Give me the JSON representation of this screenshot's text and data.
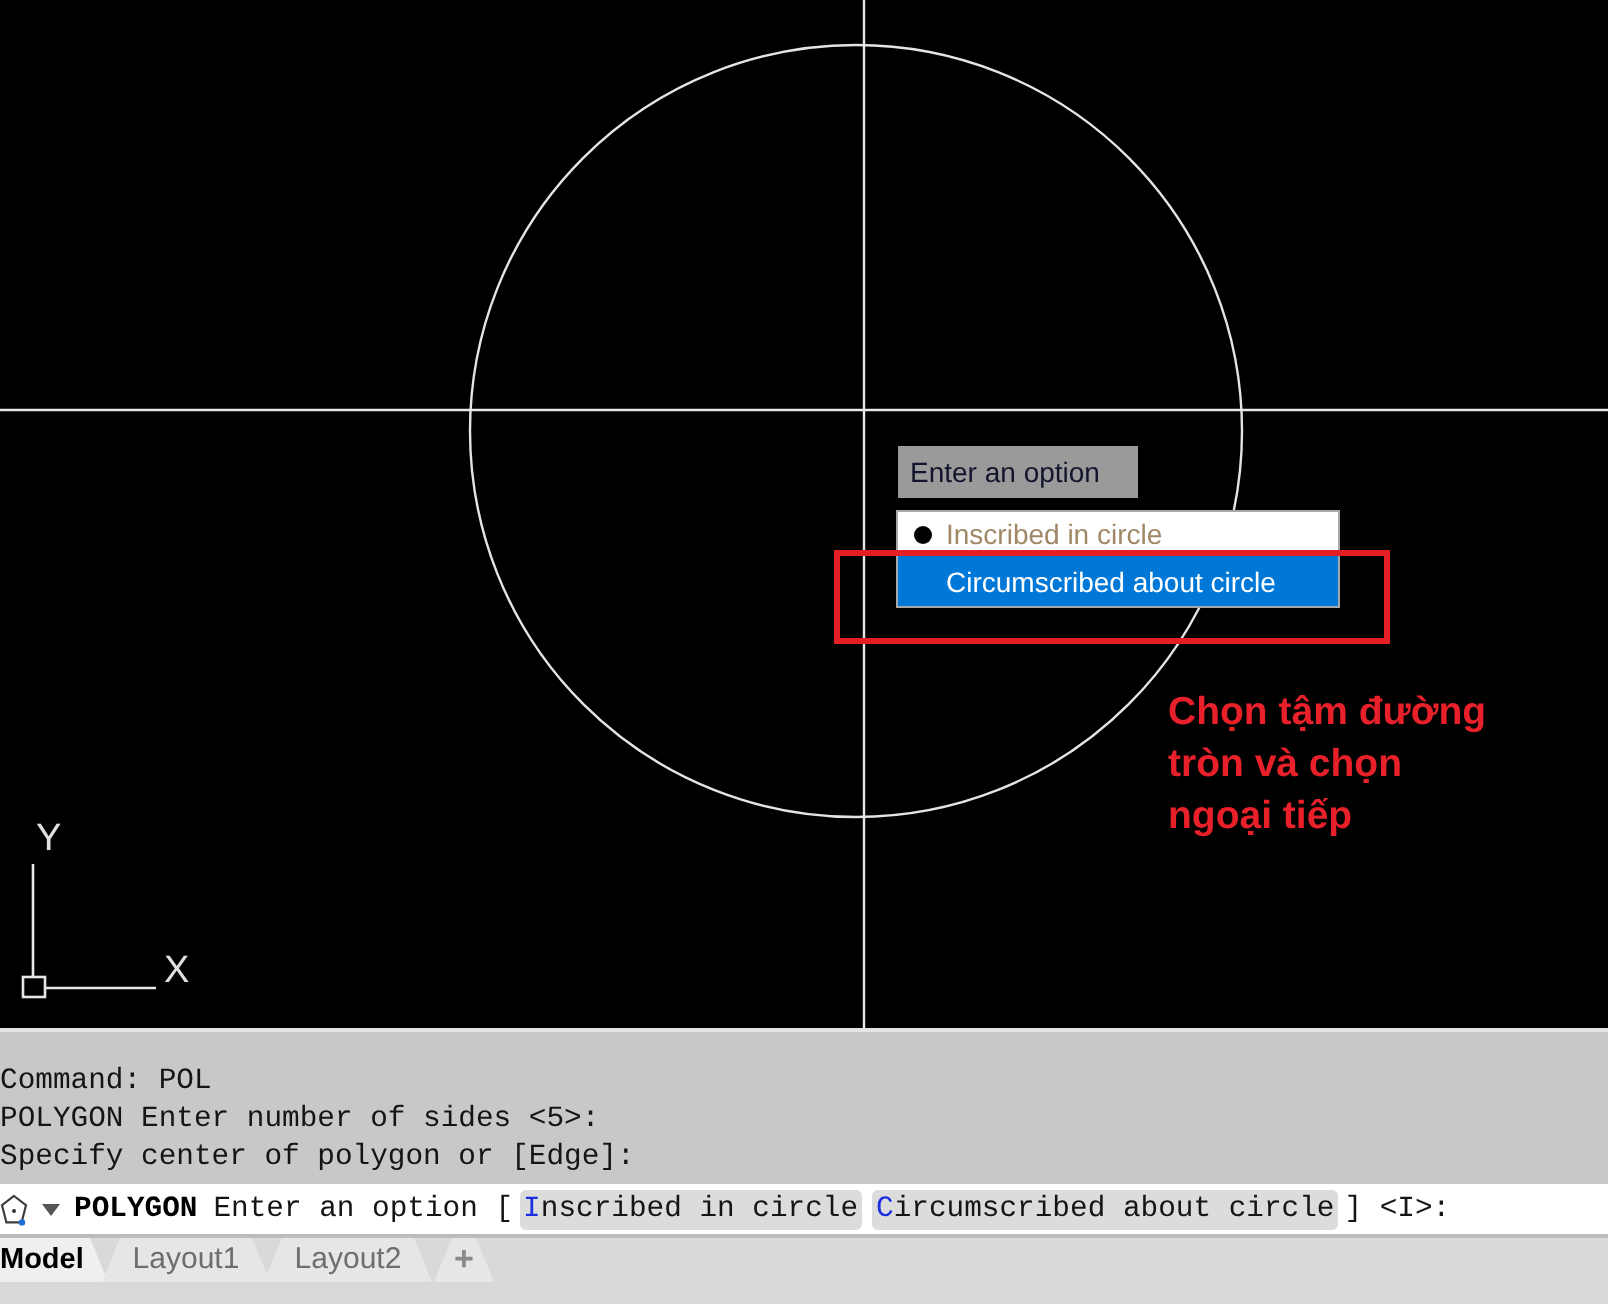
{
  "canvas": {
    "tooltip": "Enter an option",
    "option_menu": [
      {
        "label": "Inscribed in circle",
        "default": true,
        "selected": false
      },
      {
        "label": "Circumscribed about circle",
        "default": false,
        "selected": true
      }
    ],
    "annotation": [
      "Chọn tậm đường",
      "tròn và chọn",
      "ngoại tiếp"
    ],
    "ucs_icon": {
      "y_label": "Y",
      "x_label": "X"
    }
  },
  "command_history": [
    "Command: POL",
    "POLYGON Enter number of sides <5>:",
    "Specify center of polygon or [Edge]:"
  ],
  "command_line": {
    "command": "POLYGON",
    "prompt": "Enter an option [",
    "options": [
      "Inscribed in circle",
      "Circumscribed about circle"
    ],
    "suffix": "] <I>:"
  },
  "layout_tabs": [
    {
      "label": "Model",
      "selected": true
    },
    {
      "label": "Layout1",
      "selected": false
    },
    {
      "label": "Layout2",
      "selected": false
    }
  ],
  "new_tab_button": "+"
}
